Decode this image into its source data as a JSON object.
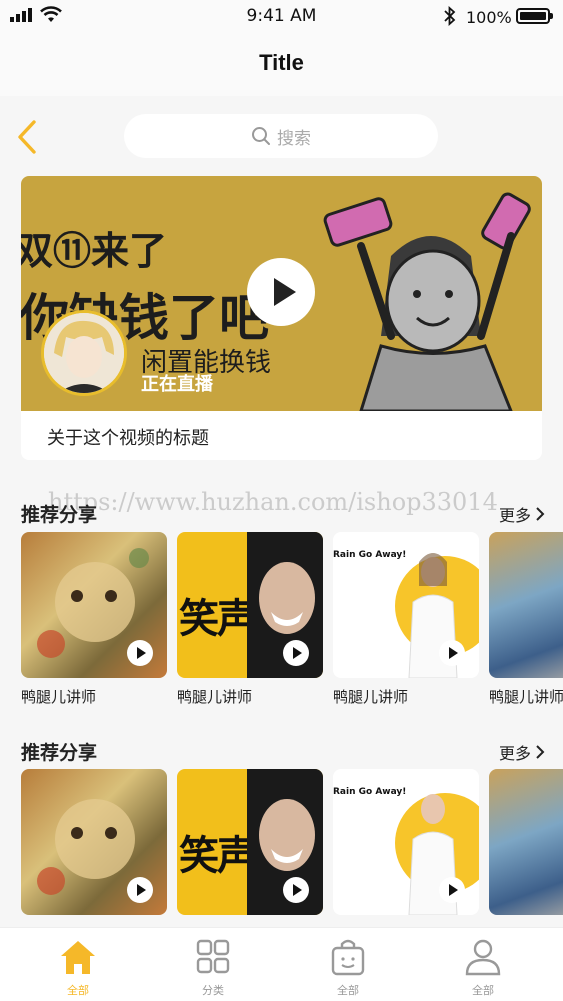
{
  "status_bar": {
    "time": "9:41 AM",
    "battery": "100%"
  },
  "nav": {
    "title": "Title"
  },
  "search": {
    "placeholder": "搜索"
  },
  "hero": {
    "thumb_line1": "双⑪来了",
    "thumb_line2": "你缺钱了吧",
    "thumb_line3": "闲置能换钱",
    "live_label": "正在直播",
    "title": "关于这个视频的标题"
  },
  "watermark": "https://www.huzhan.com/ishop33014",
  "sections": [
    {
      "title": "推荐分享",
      "more": "更多",
      "cards": [
        {
          "name": "鸭腿儿讲师",
          "thumb_text": ""
        },
        {
          "name": "鸭腿儿讲师",
          "thumb_text": "笑声"
        },
        {
          "name": "鸭腿儿讲师",
          "thumb_text": "Rain Go Away!"
        },
        {
          "name": "鸭腿儿讲师",
          "thumb_text": ""
        }
      ]
    },
    {
      "title": "推荐分享",
      "more": "更多",
      "cards": [
        {
          "name": "",
          "thumb_text": ""
        },
        {
          "name": "",
          "thumb_text": "笑声"
        },
        {
          "name": "",
          "thumb_text": "Rain Go Away!"
        },
        {
          "name": "",
          "thumb_text": ""
        }
      ]
    }
  ],
  "tabs": [
    {
      "label": "全部",
      "icon": "home-icon",
      "active": true
    },
    {
      "label": "分类",
      "icon": "grid-icon",
      "active": false
    },
    {
      "label": "全部",
      "icon": "bag-icon",
      "active": false
    },
    {
      "label": "全部",
      "icon": "user-icon",
      "active": false
    }
  ],
  "colors": {
    "accent": "#f5b829",
    "banner_bg": "#c7a43f"
  }
}
